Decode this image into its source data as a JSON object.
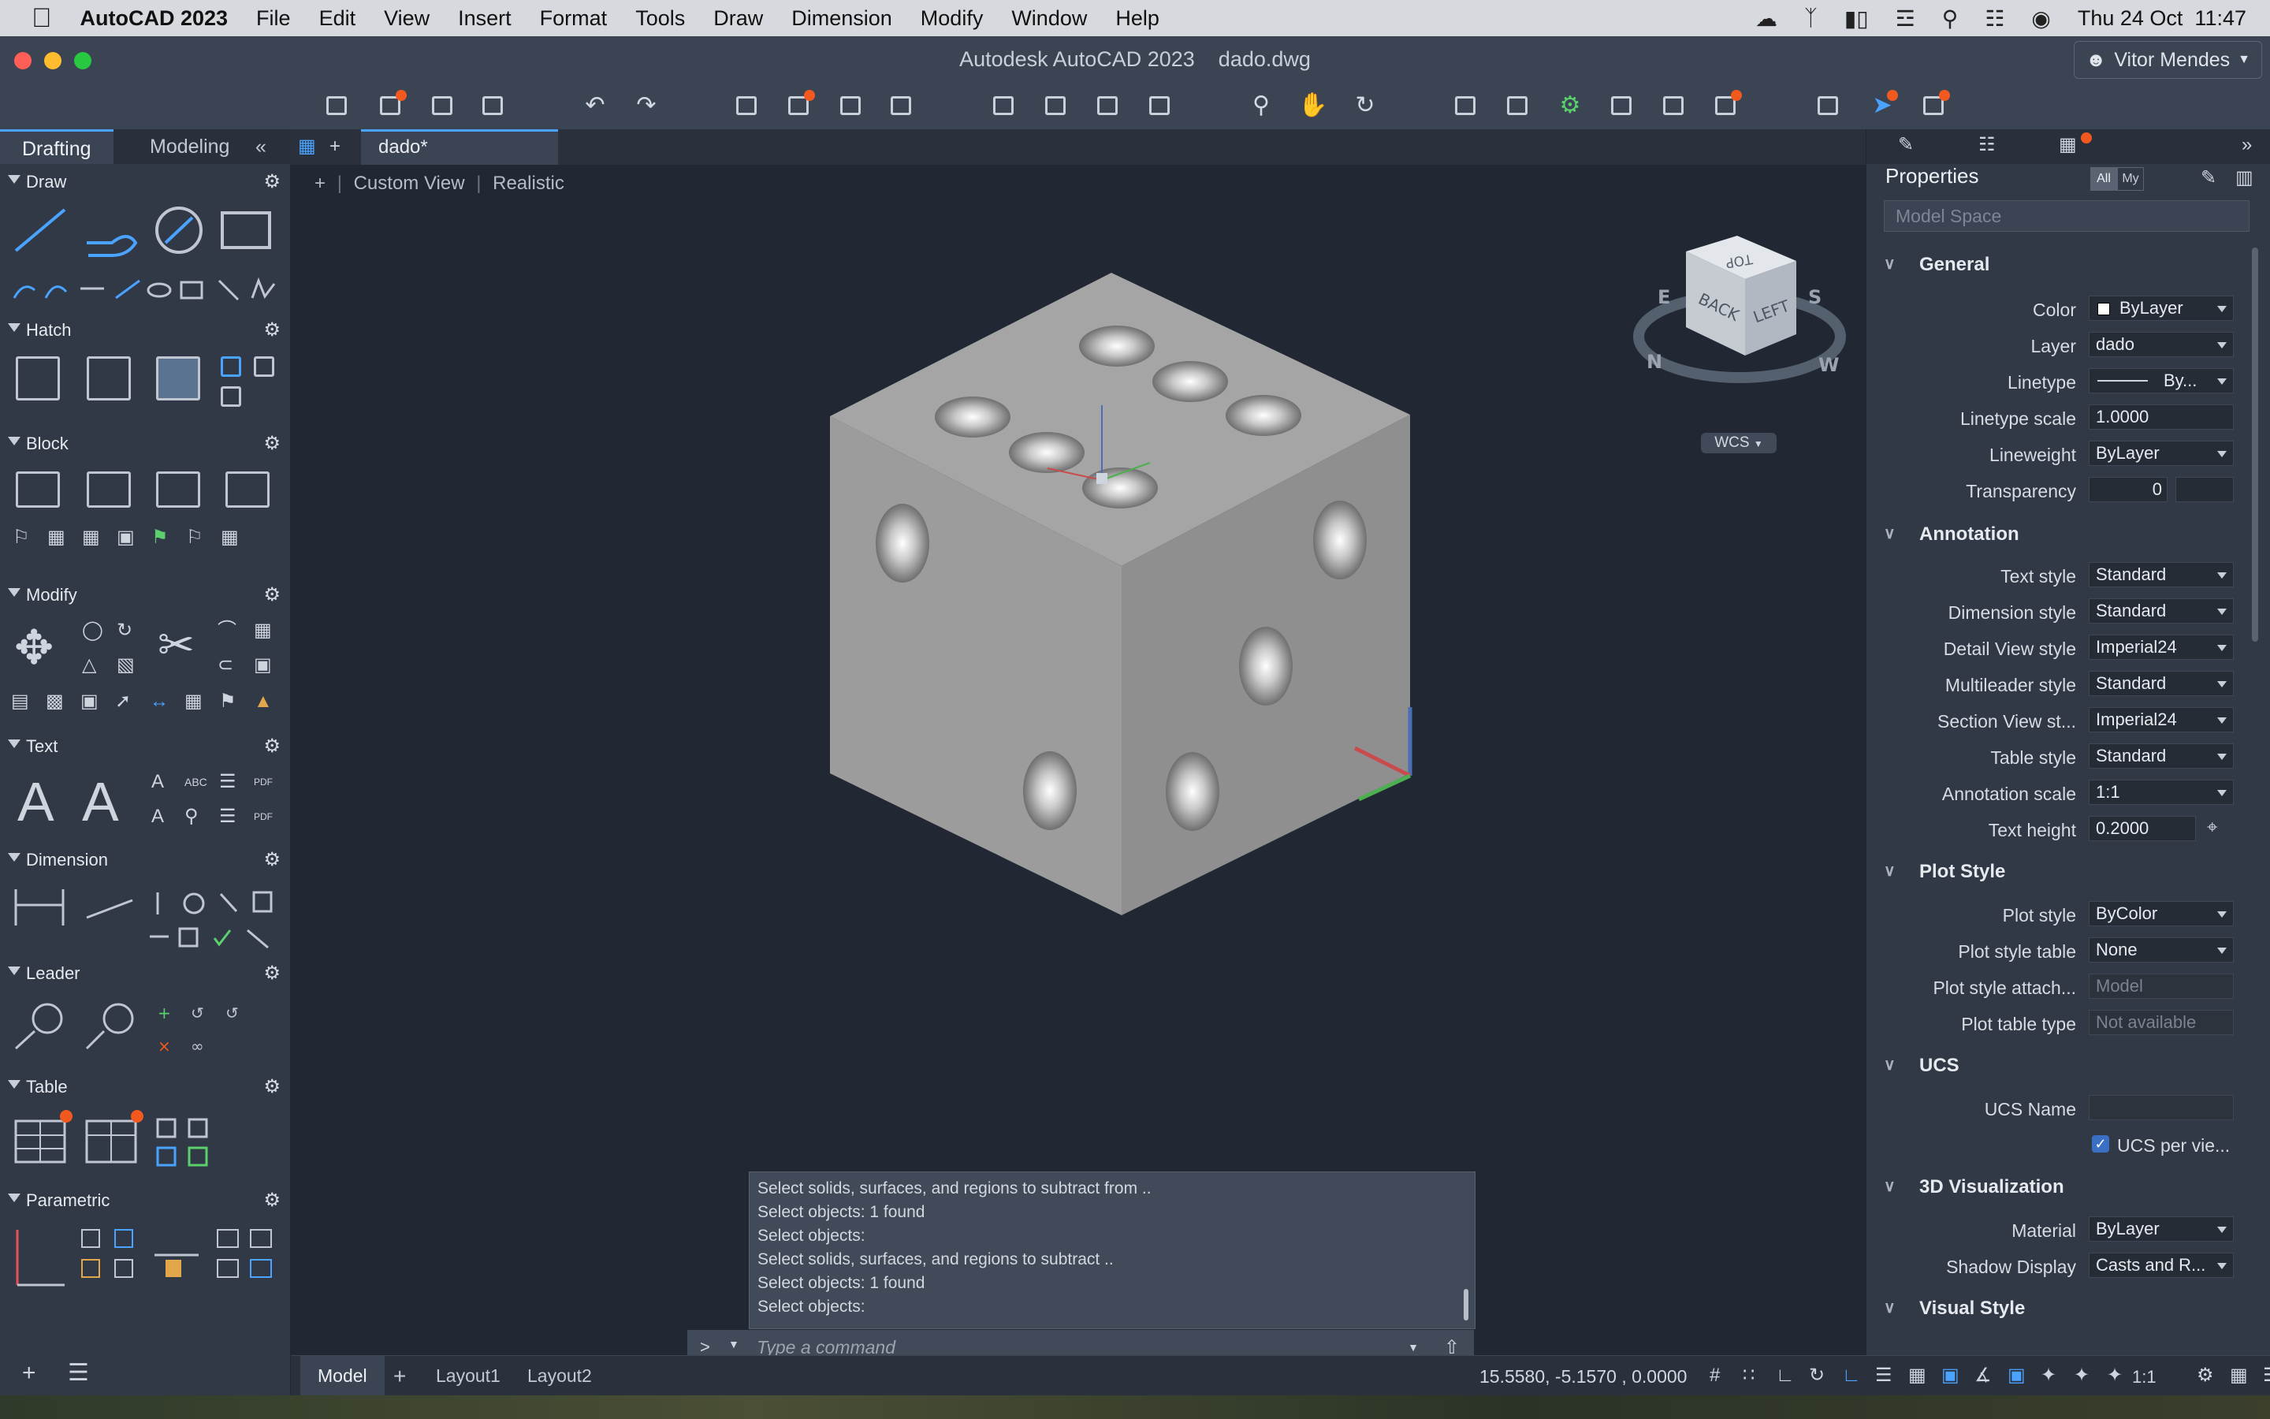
{
  "menubar": {
    "apple": "",
    "app_name": "AutoCAD 2023",
    "items": [
      "File",
      "Edit",
      "View",
      "Insert",
      "Format",
      "Tools",
      "Draw",
      "Dimension",
      "Modify",
      "Window",
      "Help"
    ],
    "clock": "Thu 24 Oct  11:47"
  },
  "window": {
    "title": "Autodesk AutoCAD 2023    dado.dwg",
    "user": "Vitor Mendes",
    "traffic_colors": [
      "#ff5f57",
      "#febc2e",
      "#28c840"
    ]
  },
  "palette": {
    "tabs": [
      "Drafting",
      "Modeling"
    ],
    "sections": [
      "Draw",
      "Hatch",
      "Block",
      "Modify",
      "Text",
      "Dimension",
      "Leader",
      "Table",
      "Parametric"
    ]
  },
  "document": {
    "tab": "dado*",
    "viewport_controls": [
      "+",
      "Custom View",
      "Realistic"
    ],
    "viewcube": {
      "top": "TOP",
      "back": "BACK",
      "left": "LEFT",
      "compass": [
        "N",
        "S",
        "W",
        "E"
      ]
    },
    "wcs": "WCS"
  },
  "command": {
    "history": [
      "Select solids, surfaces, and regions to subtract from ..",
      "Select objects: 1 found",
      "Select objects:",
      "Select solids, surfaces, and regions to subtract ..",
      "Select objects: 1 found",
      "Select objects:"
    ],
    "prompt": ">_",
    "placeholder": "Type a command"
  },
  "properties": {
    "title": "Properties",
    "filter": [
      "All",
      "My"
    ],
    "selection": "Model Space",
    "categories": [
      {
        "name": "General",
        "rows": [
          {
            "label": "Color",
            "value": "ByLayer"
          },
          {
            "label": "Layer",
            "value": "dado"
          },
          {
            "label": "Linetype",
            "value": "By..."
          },
          {
            "label": "Linetype scale",
            "value": "1.0000"
          },
          {
            "label": "Lineweight",
            "value": "ByLayer"
          },
          {
            "label": "Transparency",
            "value": "0"
          }
        ]
      },
      {
        "name": "Annotation",
        "rows": [
          {
            "label": "Text style",
            "value": "Standard"
          },
          {
            "label": "Dimension style",
            "value": "Standard"
          },
          {
            "label": "Detail View style",
            "value": "Imperial24"
          },
          {
            "label": "Multileader style",
            "value": "Standard"
          },
          {
            "label": "Section View st...",
            "value": "Imperial24"
          },
          {
            "label": "Table style",
            "value": "Standard"
          },
          {
            "label": "Annotation scale",
            "value": "1:1"
          },
          {
            "label": "Text height",
            "value": "0.2000"
          }
        ]
      },
      {
        "name": "Plot Style",
        "rows": [
          {
            "label": "Plot style",
            "value": "ByColor"
          },
          {
            "label": "Plot style table",
            "value": "None"
          },
          {
            "label": "Plot style attach...",
            "value": "Model"
          },
          {
            "label": "Plot table type",
            "value": "Not available"
          }
        ]
      },
      {
        "name": "UCS",
        "rows": [
          {
            "label": "UCS Name",
            "value": ""
          },
          {
            "label": "",
            "value": "UCS per vie..."
          }
        ]
      },
      {
        "name": "3D Visualization",
        "rows": [
          {
            "label": "Material",
            "value": "ByLayer"
          },
          {
            "label": "Shadow Display",
            "value": "Casts and R..."
          }
        ]
      },
      {
        "name": "Visual Style",
        "rows": []
      }
    ]
  },
  "status": {
    "layout_tabs": [
      "Model",
      "Layout1",
      "Layout2"
    ],
    "coords": "15.5580, -5.1570 , 0.0000",
    "scale": "1:1"
  },
  "colors": {
    "accent": "#4aa3ff",
    "badge": "#f2591e"
  }
}
